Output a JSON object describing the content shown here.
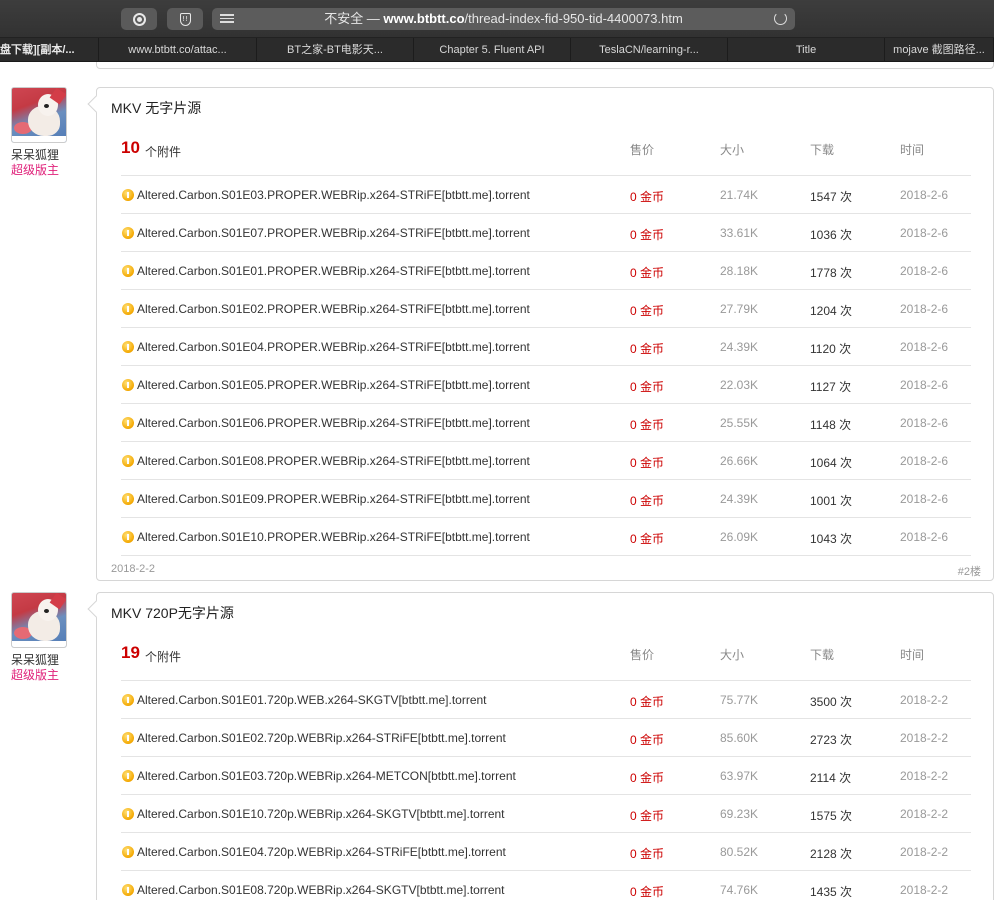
{
  "browser": {
    "url_prefix": "不安全 — ",
    "url_domain": "www.btbtt.co",
    "url_path": "/thread-index-fid-950-tid-4400073.htm",
    "tabs": [
      {
        "label": "盘下载][副本/..."
      },
      {
        "label": "www.btbtt.co/attac..."
      },
      {
        "label": "BT之家-BT电影天..."
      },
      {
        "label": "Chapter 5. Fluent API"
      },
      {
        "label": "TeslaCN/learning-r..."
      },
      {
        "label": "Title"
      },
      {
        "label": "mojave 截图路径..."
      }
    ]
  },
  "posts": [
    {
      "user": {
        "name": "呆呆狐狸",
        "role": "超级版主"
      },
      "title": "MKV 无字片源",
      "attach_count": "10",
      "attach_label": "个附件",
      "columns": {
        "price": "售价",
        "size": "大小",
        "downloads": "下载",
        "time": "时间"
      },
      "files": [
        {
          "name": "Altered.Carbon.S01E03.PROPER.WEBRip.x264-STRiFE[btbtt.me].torrent",
          "price": "0 金币",
          "size": "21.74K",
          "downloads": "1547 次",
          "time": "2018-2-6"
        },
        {
          "name": "Altered.Carbon.S01E07.PROPER.WEBRip.x264-STRiFE[btbtt.me].torrent",
          "price": "0 金币",
          "size": "33.61K",
          "downloads": "1036 次",
          "time": "2018-2-6"
        },
        {
          "name": "Altered.Carbon.S01E01.PROPER.WEBRip.x264-STRiFE[btbtt.me].torrent",
          "price": "0 金币",
          "size": "28.18K",
          "downloads": "1778 次",
          "time": "2018-2-6"
        },
        {
          "name": "Altered.Carbon.S01E02.PROPER.WEBRip.x264-STRiFE[btbtt.me].torrent",
          "price": "0 金币",
          "size": "27.79K",
          "downloads": "1204 次",
          "time": "2018-2-6"
        },
        {
          "name": "Altered.Carbon.S01E04.PROPER.WEBRip.x264-STRiFE[btbtt.me].torrent",
          "price": "0 金币",
          "size": "24.39K",
          "downloads": "1120 次",
          "time": "2018-2-6"
        },
        {
          "name": "Altered.Carbon.S01E05.PROPER.WEBRip.x264-STRiFE[btbtt.me].torrent",
          "price": "0 金币",
          "size": "22.03K",
          "downloads": "1127 次",
          "time": "2018-2-6"
        },
        {
          "name": "Altered.Carbon.S01E06.PROPER.WEBRip.x264-STRiFE[btbtt.me].torrent",
          "price": "0 金币",
          "size": "25.55K",
          "downloads": "1148 次",
          "time": "2018-2-6"
        },
        {
          "name": "Altered.Carbon.S01E08.PROPER.WEBRip.x264-STRiFE[btbtt.me].torrent",
          "price": "0 金币",
          "size": "26.66K",
          "downloads": "1064 次",
          "time": "2018-2-6"
        },
        {
          "name": "Altered.Carbon.S01E09.PROPER.WEBRip.x264-STRiFE[btbtt.me].torrent",
          "price": "0 金币",
          "size": "24.39K",
          "downloads": "1001 次",
          "time": "2018-2-6"
        },
        {
          "name": "Altered.Carbon.S01E10.PROPER.WEBRip.x264-STRiFE[btbtt.me].torrent",
          "price": "0 金币",
          "size": "26.09K",
          "downloads": "1043 次",
          "time": "2018-2-6"
        }
      ],
      "post_date": "2018-2-2",
      "floor": "#2楼"
    },
    {
      "user": {
        "name": "呆呆狐狸",
        "role": "超级版主"
      },
      "title": "MKV 720P无字片源",
      "attach_count": "19",
      "attach_label": "个附件",
      "columns": {
        "price": "售价",
        "size": "大小",
        "downloads": "下载",
        "time": "时间"
      },
      "files": [
        {
          "name": "Altered.Carbon.S01E01.720p.WEB.x264-SKGTV[btbtt.me].torrent",
          "price": "0 金币",
          "size": "75.77K",
          "downloads": "3500 次",
          "time": "2018-2-2"
        },
        {
          "name": "Altered.Carbon.S01E02.720p.WEBRip.x264-STRiFE[btbtt.me].torrent",
          "price": "0 金币",
          "size": "85.60K",
          "downloads": "2723 次",
          "time": "2018-2-2"
        },
        {
          "name": "Altered.Carbon.S01E03.720p.WEBRip.x264-METCON[btbtt.me].torrent",
          "price": "0 金币",
          "size": "63.97K",
          "downloads": "2114 次",
          "time": "2018-2-2"
        },
        {
          "name": "Altered.Carbon.S01E10.720p.WEBRip.x264-SKGTV[btbtt.me].torrent",
          "price": "0 金币",
          "size": "69.23K",
          "downloads": "1575 次",
          "time": "2018-2-2"
        },
        {
          "name": "Altered.Carbon.S01E04.720p.WEBRip.x264-STRiFE[btbtt.me].torrent",
          "price": "0 金币",
          "size": "80.52K",
          "downloads": "2128 次",
          "time": "2018-2-2"
        },
        {
          "name": "Altered.Carbon.S01E08.720p.WEBRip.x264-SKGTV[btbtt.me].torrent",
          "price": "0 金币",
          "size": "74.76K",
          "downloads": "1435 次",
          "time": "2018-2-2"
        }
      ]
    }
  ]
}
